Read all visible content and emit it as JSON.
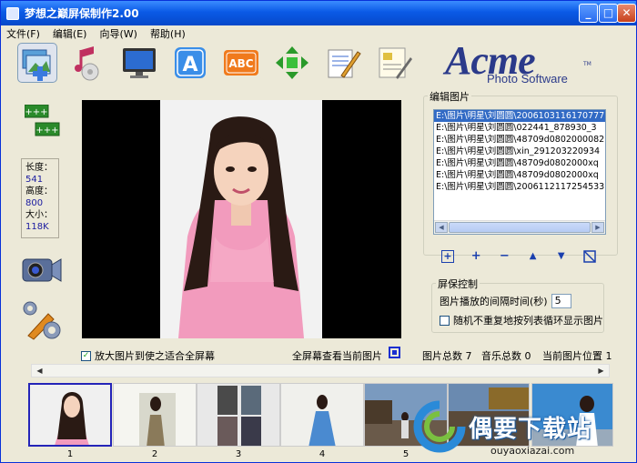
{
  "window": {
    "title": "梦想之巅屏保制作2.00"
  },
  "menu": [
    "文件(F)",
    "编辑(E)",
    "向导(W)",
    "帮助(H)"
  ],
  "toolbar_icons": [
    "photo-edit-icon",
    "music-icon",
    "monitor-icon",
    "text-a-icon",
    "abc-text-icon",
    "move-arrows-icon",
    "document-pen-icon",
    "properties-icon"
  ],
  "logo": {
    "big": "Acme",
    "small": "Photo Software",
    "tm": "TM"
  },
  "info": {
    "length_label": "长度：",
    "length": "541",
    "height_label": "高度：",
    "height": "800",
    "size_label": "大小：",
    "size": "118K"
  },
  "edit_group": {
    "label": "编辑图片",
    "files": [
      "E:\\图片\\明星\\刘圆圆\\2006103116170777",
      "E:\\图片\\明星\\刘圆圆\\022441_878930_3",
      "E:\\图片\\明星\\刘圆圆\\48709d0802000082",
      "E:\\图片\\明星\\刘圆圆\\xin_291203220934",
      "E:\\图片\\明星\\刘圆圆\\48709d0802000xq",
      "E:\\图片\\明星\\刘圆圆\\48709d0802000xq",
      "E:\\图片\\明星\\刘圆圆\\2006112117254533"
    ],
    "buttons": [
      "add-all-icon",
      "add-icon",
      "remove-icon",
      "move-up-icon",
      "move-down-icon",
      "clear-icon"
    ]
  },
  "screensaver": {
    "label": "屏保控制",
    "interval_label": "图片播放的间隔时间(秒)",
    "interval": "5",
    "random_label": "随机不重复地按列表循环显示图片"
  },
  "fit_screen_label": "放大图片到使之适合全屏幕",
  "fullscreen_label": "全屏幕查看当前图片",
  "status": {
    "total_images": "图片总数 7",
    "music_total": "音乐总数 0",
    "current_pos": "当前图片位置 1"
  },
  "thumbs": [
    "1",
    "2",
    "3",
    "4",
    "5"
  ],
  "watermark": {
    "text": "偶要下载站",
    "url": "ouyaoxiazai.com"
  },
  "colors": {
    "titlebar": "#0a5ae6",
    "select": "#316ac5",
    "accent_blue": "#1a3fae"
  }
}
